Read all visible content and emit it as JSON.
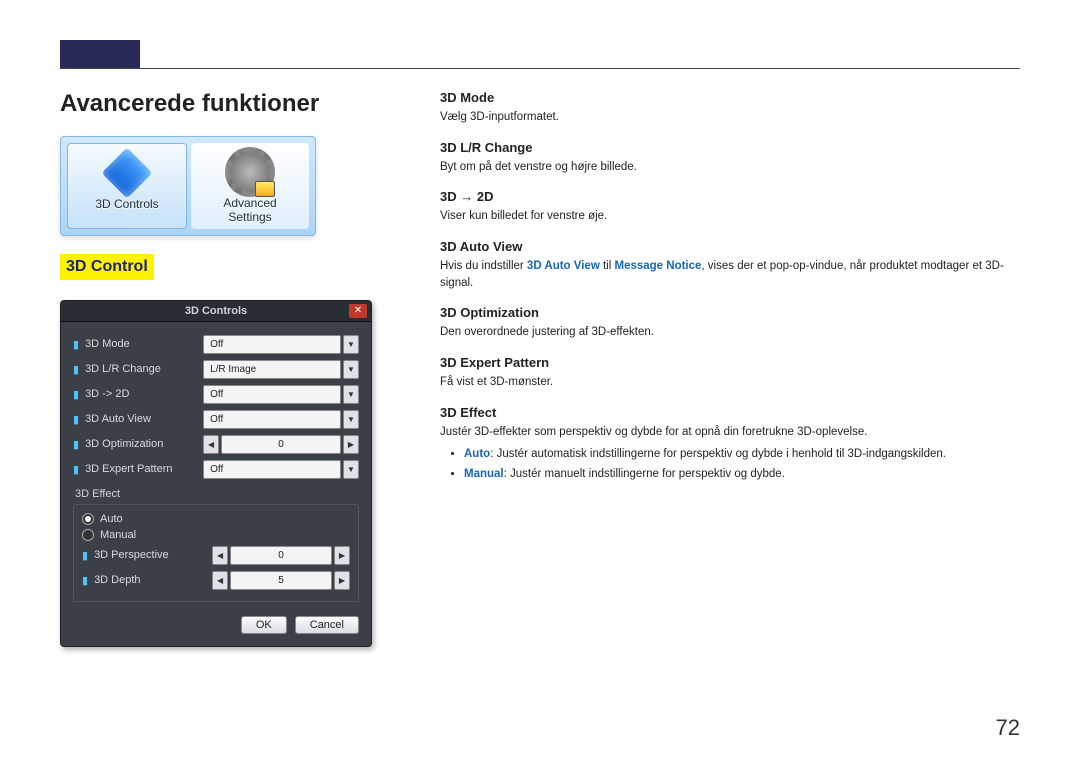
{
  "header": {
    "section_title": "Avancerede funktioner",
    "sub_heading": "3D Control",
    "page_number": "72"
  },
  "icon_row": {
    "items": [
      {
        "label": "3D Controls",
        "icon": "cube-icon"
      },
      {
        "label": "Advanced\nSettings",
        "icon": "gear-icon"
      }
    ]
  },
  "panel": {
    "title": "3D Controls",
    "close_glyph": "✕",
    "rows": [
      {
        "label": "3D Mode",
        "value": "Off",
        "type": "dropdown"
      },
      {
        "label": "3D L/R Change",
        "value": "L/R Image",
        "type": "dropdown"
      },
      {
        "label": "3D -> 2D",
        "value": "Off",
        "type": "dropdown"
      },
      {
        "label": "3D Auto View",
        "value": "Off",
        "type": "dropdown"
      },
      {
        "label": "3D Optimization",
        "value": "0",
        "type": "stepper"
      },
      {
        "label": "3D Expert Pattern",
        "value": "Off",
        "type": "dropdown"
      }
    ],
    "effect_group": {
      "title": "3D Effect",
      "radios": [
        {
          "label": "Auto",
          "checked": true
        },
        {
          "label": "Manual",
          "checked": false
        }
      ],
      "sub_rows": [
        {
          "label": "3D Perspective",
          "value": "0",
          "type": "stepper"
        },
        {
          "label": "3D Depth",
          "value": "5",
          "type": "stepper"
        }
      ]
    },
    "buttons": {
      "ok": "OK",
      "cancel": "Cancel"
    }
  },
  "right": {
    "entries": [
      {
        "title": "3D Mode",
        "desc": "Vælg 3D-inputformatet."
      },
      {
        "title": "3D L/R Change",
        "desc": "Byt om på det venstre og højre billede."
      },
      {
        "title": "3D → 2D",
        "desc": "Viser kun billedet for venstre øje."
      },
      {
        "title": "3D Auto View",
        "desc_pre": "Hvis du indstiller ",
        "desc_kw1": "3D Auto View",
        "desc_mid": " til ",
        "desc_kw2": "Message Notice",
        "desc_post": ", vises der et pop-op-vindue, når produktet modtager et 3D-signal."
      },
      {
        "title": "3D Optimization",
        "desc": "Den overordnede justering af 3D-effekten."
      },
      {
        "title": "3D Expert Pattern",
        "desc": "Få vist et 3D-mønster."
      },
      {
        "title": "3D Effect",
        "desc": "Justér 3D-effekter som perspektiv og dybde for at opnå din foretrukne 3D-oplevelse.",
        "bullets": [
          {
            "kw": "Auto",
            "text": ": Justér automatisk indstillingerne for perspektiv og dybde i henhold til 3D-indgangskilden."
          },
          {
            "kw": "Manual",
            "text": ": Justér manuelt indstillingerne for perspektiv og dybde."
          }
        ]
      }
    ]
  }
}
